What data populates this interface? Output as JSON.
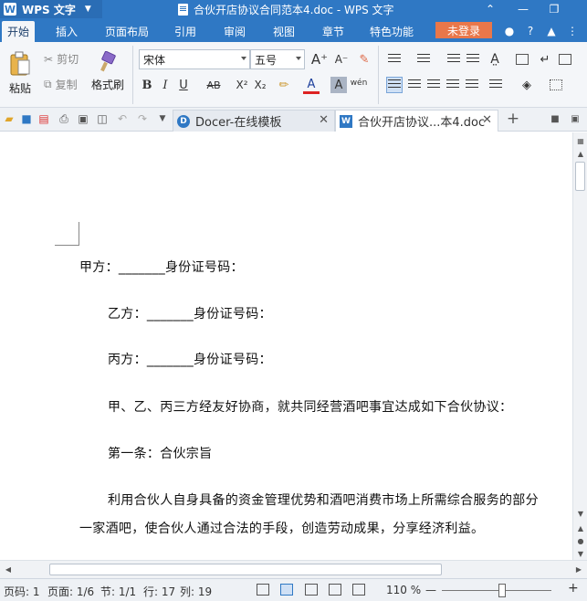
{
  "titlebar": {
    "app_name": "WPS 文字",
    "doc_title": "合伙开店协议合同范本4.doc - WPS 文字"
  },
  "menu": {
    "tabs": [
      "开始",
      "插入",
      "页面布局",
      "引用",
      "审阅",
      "视图",
      "章节",
      "特色功能"
    ],
    "active_tab": "开始",
    "login_label": "未登录"
  },
  "ribbon": {
    "paste_label": "粘贴",
    "cut_label": "剪切",
    "copy_label": "复制",
    "format_painter_label": "格式刷",
    "font_name": "宋体",
    "font_size": "五号",
    "bold": "B",
    "italic": "I",
    "underline": "U",
    "strikethrough": "AB",
    "superscript": "X²",
    "subscript": "X₂",
    "font_color": "A",
    "char_shading": "A",
    "phonetic": "wén"
  },
  "doc_tabs": [
    {
      "label": "Docer-在线模板",
      "active": false
    },
    {
      "label": "合伙开店协议...本4.doc",
      "active": true
    }
  ],
  "document": {
    "paragraphs": [
      "甲方：_______身份证号码：",
      "乙方：_______身份证号码：",
      "丙方：_______身份证号码：",
      "甲、乙、丙三方经友好协商，就共同经营酒吧事宜达成如下合伙协议：",
      "第一条：合伙宗旨",
      "利用合伙人自身具备的资金管理优势和酒吧消费市场上所需综合服务的部分",
      "一家酒吧，使合伙人通过合法的手段，创造劳动成果，分享经济利益。"
    ]
  },
  "statusbar": {
    "page_code": "页码: 1",
    "page": "页面: 1/6",
    "section": "节: 1/1",
    "row": "行: 17",
    "col": "列: 19",
    "zoom": "110 %",
    "zoom_minus": "—",
    "zoom_plus": "+"
  }
}
